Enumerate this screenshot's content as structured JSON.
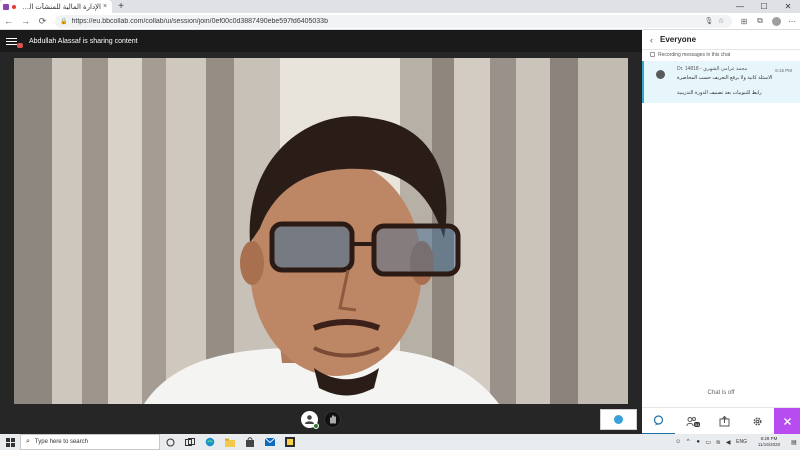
{
  "browser": {
    "tab_title": "الإدارة المالية للمنشآت الصحية",
    "tab_close": "×",
    "new_tab": "+",
    "url": "https://eu.bbcollab.com/collab/ui/session/join/0ef00c0d3887490ebe597fd6405033b",
    "window_controls": [
      "—",
      "☐",
      "✕"
    ],
    "nav": {
      "back": "←",
      "forward": "→",
      "reload": "⟳"
    }
  },
  "stage": {
    "sharing_text": "Abdullah Alassaf is sharing content"
  },
  "panel": {
    "title": "Everyone",
    "recording_note": "Recording messages in this chat",
    "message": {
      "author": "Dr. 14818 - محمد غرامي الشهري",
      "time": "6:15 PM",
      "line1": "الاسئلة كانية ولا برفع التعريف حسب المحاضرة",
      "line2": "رايط للتبويبات بعد تصنيف الدورة التدريبية"
    },
    "chat_off": "Chat is off",
    "attendee_count": "54"
  },
  "taskbar": {
    "search_placeholder": "Type here to search",
    "language": "ENG",
    "time": "6:28 PM",
    "date": "11/16/2020"
  },
  "colors": {
    "accent": "#1d6fa5",
    "close_purple": "#b74df0",
    "message_bg": "#e7f6fb"
  }
}
